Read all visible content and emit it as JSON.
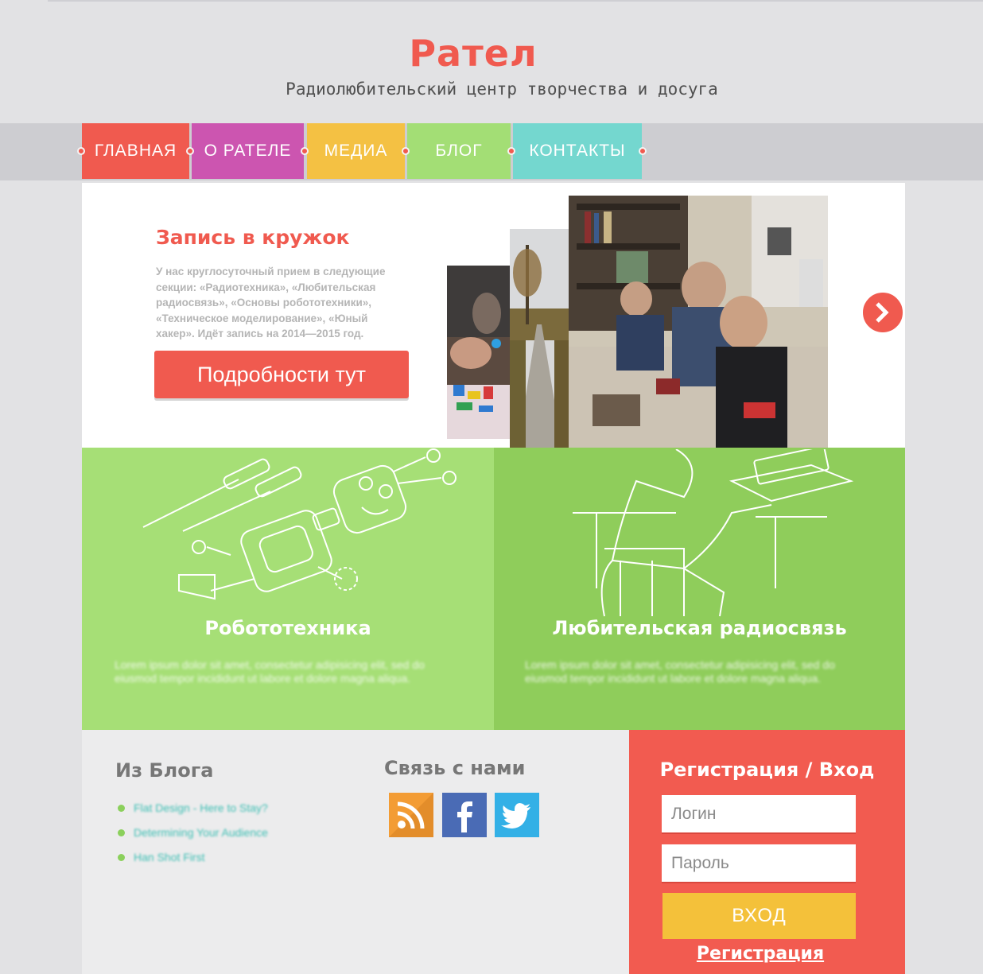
{
  "header": {
    "title": "Рател",
    "subtitle": "Радиолюбительский центр творчества и досуга"
  },
  "nav": {
    "items": [
      {
        "label": "ГЛАВНАЯ",
        "color": "#f05a4f"
      },
      {
        "label": "О РАТЕЛЕ",
        "color": "#cc55b0"
      },
      {
        "label": "МЕДИА",
        "color": "#f4c143"
      },
      {
        "label": "БЛОГ",
        "color": "#a3de75"
      },
      {
        "label": "КОНТАКТЫ",
        "color": "#74d7cf"
      }
    ]
  },
  "hero": {
    "title": "Запись в кружок",
    "text": "У нас круглосуточный прием в следующие секции: «Радиотехника», «Любительская радиосвязь», «Основы робототехники», «Техническое моделирование», «Юный хакер». Идёт запись на 2014—2015 год.",
    "button_label": "Подробности тут"
  },
  "features": [
    {
      "title": "Робототехника",
      "text": "Lorem ipsum dolor sit amet, consectetur adipisicing elit, sed do eiusmod tempor incididunt ut labore et dolore magna aliqua."
    },
    {
      "title": "Любительская радиосвязь",
      "text": "Lorem ipsum dolor sit amet, consectetur adipisicing elit, sed do eiusmod tempor incididunt ut labore et dolore magna aliqua."
    }
  ],
  "blog": {
    "title": "Из Блога",
    "items": [
      "Flat Design - Here to Stay?",
      "Determining Your Audience",
      "Han Shot First"
    ]
  },
  "contact": {
    "title": "Связь с нами",
    "icons": [
      "rss-icon",
      "facebook-icon",
      "twitter-icon"
    ]
  },
  "login": {
    "title": "Регистрация / Вход",
    "login_placeholder": "Логин",
    "password_placeholder": "Пароль",
    "submit_label": "ВХОД",
    "register_label": "Регистрация"
  },
  "colors": {
    "accent": "#f05a4f",
    "green_light": "#a6df76",
    "green_dark": "#8fcd5b",
    "yellow": "#f4c13a"
  }
}
